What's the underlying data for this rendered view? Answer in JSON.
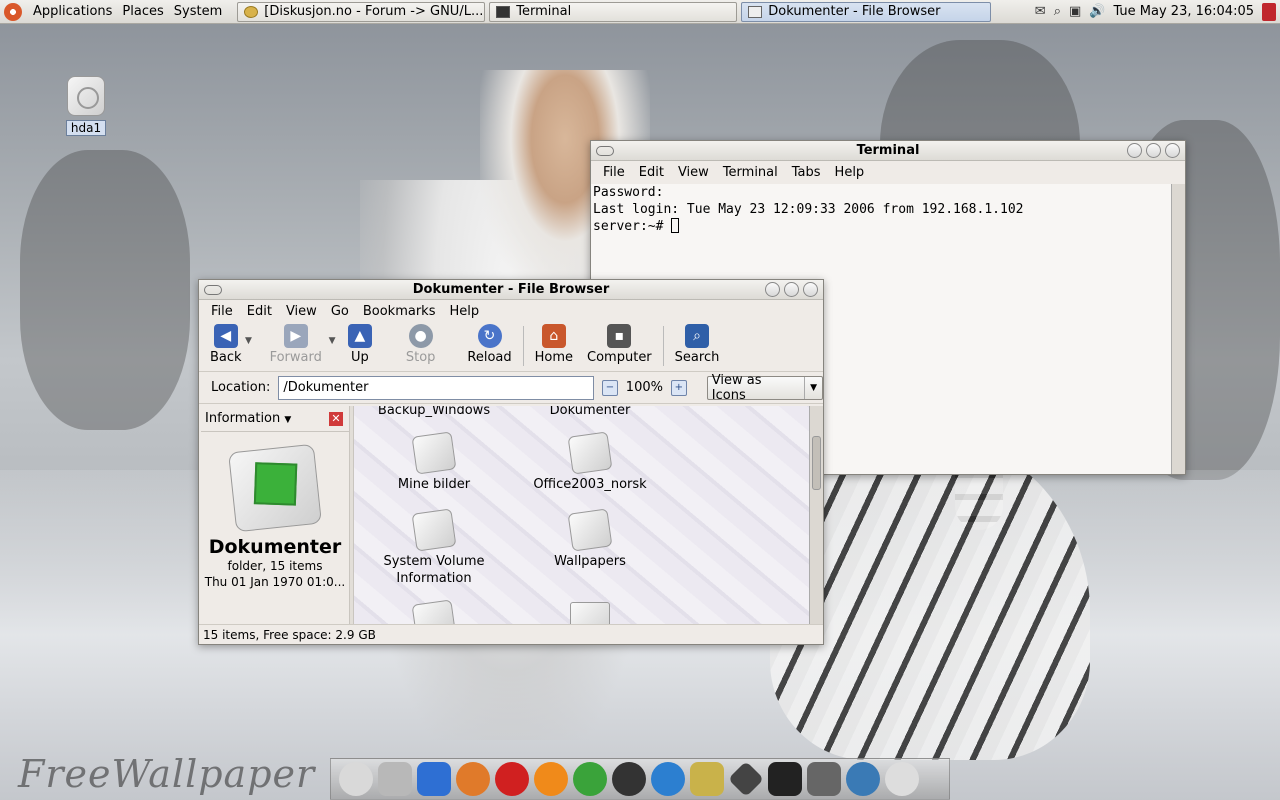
{
  "top_panel": {
    "menus": [
      "Applications",
      "Places",
      "System"
    ],
    "tasks": [
      {
        "label": "[Diskusjon.no - Forum -> GNU/L...",
        "active": false
      },
      {
        "label": "Terminal",
        "active": false
      },
      {
        "label": "Dokumenter - File Browser",
        "active": true
      }
    ],
    "clock": "Tue May 23, 16:04:05",
    "tray_icons": [
      "mail-icon",
      "search-icon",
      "network-icon",
      "volume-icon",
      "logout-icon"
    ]
  },
  "desktop": {
    "icon_label": "hda1",
    "wallpaper_credit": "FreeWallpaper"
  },
  "terminal": {
    "title": "Terminal",
    "menu": [
      "File",
      "Edit",
      "View",
      "Terminal",
      "Tabs",
      "Help"
    ],
    "lines": [
      "Password:",
      "Last login: Tue May 23 12:09:33 2006 from 192.168.1.102"
    ],
    "prompt": "server:~# "
  },
  "file_browser": {
    "title": "Dokumenter - File Browser",
    "menu": [
      "File",
      "Edit",
      "View",
      "Go",
      "Bookmarks",
      "Help"
    ],
    "toolbar": {
      "back": "Back",
      "forward": "Forward",
      "up": "Up",
      "stop": "Stop",
      "reload": "Reload",
      "home": "Home",
      "computer": "Computer",
      "search": "Search"
    },
    "location_label": "Location:",
    "location_value": "/Dokumenter",
    "zoom": "100%",
    "view_mode": "View as Icons",
    "side_pane": {
      "mode": "Information",
      "name": "Dokumenter",
      "kind": "folder, 15 items",
      "date": "Thu 01 Jan 1970 01:0..."
    },
    "items": [
      {
        "label": "Backup_Windows"
      },
      {
        "label": "Dokumenter"
      },
      {
        "label": "Mine bilder"
      },
      {
        "label": "Office2003_norsk"
      },
      {
        "label": "System Volume Information"
      },
      {
        "label": "Wallpapers"
      }
    ],
    "status": "15 items, Free space: 2.9 GB"
  },
  "colors": {
    "accent": "#3a63b5",
    "folder_green": "#3bb13a",
    "close_red": "#d03a3a"
  }
}
